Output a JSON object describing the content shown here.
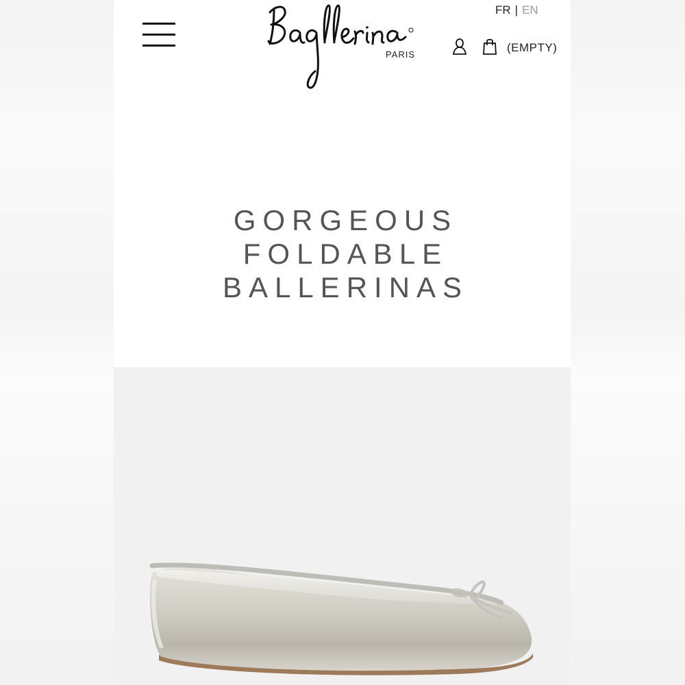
{
  "header": {
    "brand": "Bagllerina",
    "brand_sub": "PARIS",
    "lang_fr": "FR",
    "lang_sep": "|",
    "lang_en": "EN",
    "cart_label": "(EMPTY)"
  },
  "hero": {
    "line1": "GORGEOUS",
    "line2": "FOLDABLE",
    "line3": "BALLERINAS"
  },
  "icons": {
    "menu": "hamburger-menu-icon",
    "account": "user-icon",
    "cart": "shopping-bag-icon"
  },
  "colors": {
    "text": "#222222",
    "headline": "#555555",
    "lang_inactive": "#999999",
    "product_bg": "#f1f1f1"
  }
}
